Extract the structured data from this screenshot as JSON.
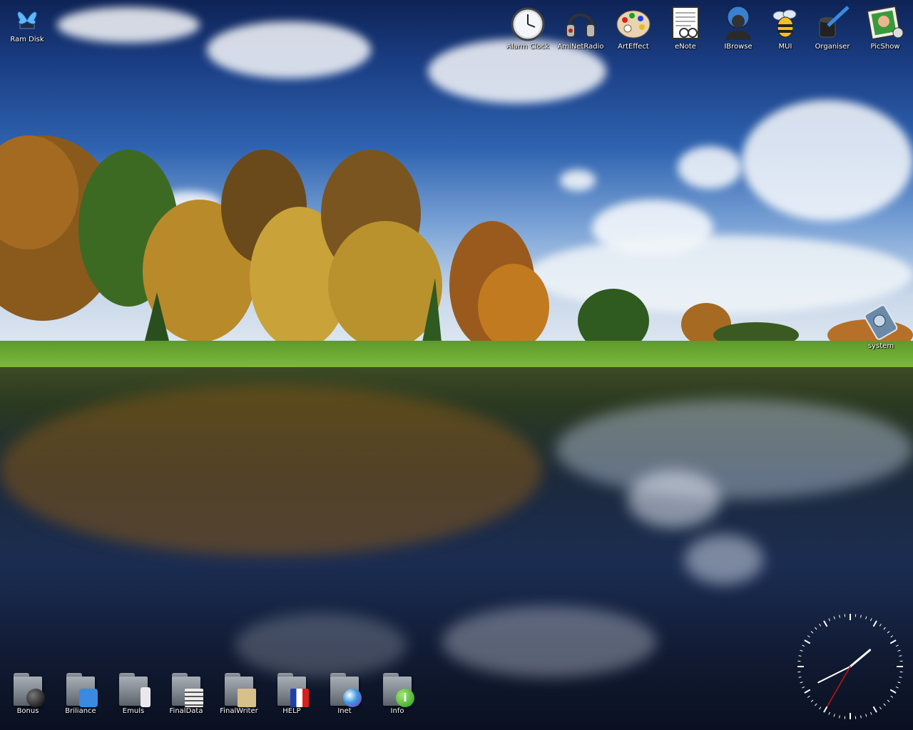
{
  "desktop": {
    "top_left_icons": [
      {
        "label": "Ram Disk",
        "icon": "butterfly-ramdisk-icon"
      }
    ],
    "top_bar_icons": [
      {
        "label": "Alarm Clock",
        "icon": "alarm-clock-icon"
      },
      {
        "label": "AmiNetRadio",
        "icon": "headphones-icon"
      },
      {
        "label": "ArtEffect",
        "icon": "paint-palette-icon"
      },
      {
        "label": "eNote",
        "icon": "notepad-icon"
      },
      {
        "label": "IBrowse",
        "icon": "globe-person-icon"
      },
      {
        "label": "MUI",
        "icon": "bee-icon"
      },
      {
        "label": "Organiser",
        "icon": "ink-pen-icon"
      },
      {
        "label": "PicShow",
        "icon": "picture-icon"
      }
    ],
    "side_icons": [
      {
        "label": "system",
        "icon": "hard-drive-icon"
      }
    ],
    "bottom_drawers": [
      {
        "label": "Bonus",
        "icon": "bomb-folder-icon"
      },
      {
        "label": "Briliance",
        "icon": "paint-cup-folder-icon"
      },
      {
        "label": "Emuls",
        "icon": "computer-folder-icon"
      },
      {
        "label": "FinalData",
        "icon": "books-folder-icon"
      },
      {
        "label": "FinalWriter",
        "icon": "papers-folder-icon"
      },
      {
        "label": "HELP",
        "icon": "french-flag-folder-icon"
      },
      {
        "label": "Inet",
        "icon": "globe-folder-icon"
      },
      {
        "label": "Info",
        "icon": "info-folder-icon"
      }
    ]
  },
  "colors": {
    "label_text": "#ffffff",
    "clock_hand_second": "#d01010",
    "clock_hand": "#ffffff"
  },
  "clock": {
    "time_hours": 1,
    "time_minutes": 40,
    "time_seconds": 35
  }
}
